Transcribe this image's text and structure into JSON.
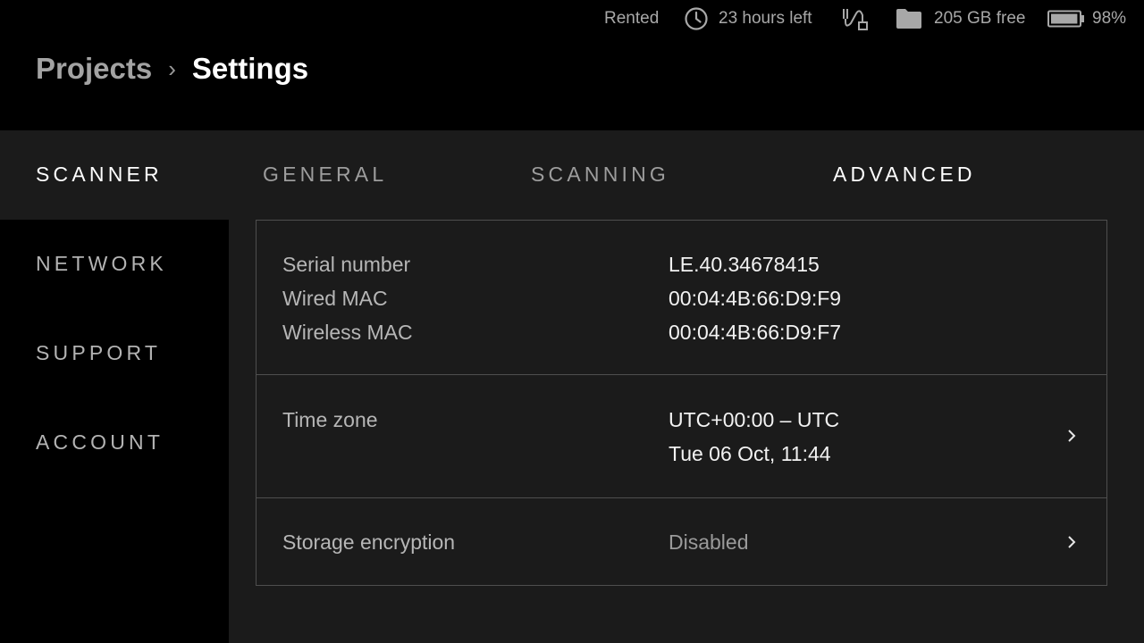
{
  "status": {
    "rental": "Rented",
    "time_left": "23 hours left",
    "storage_free": "205 GB free",
    "battery_percent": "98%",
    "battery_level": 0.98,
    "icons": [
      "clock-icon",
      "cable-icon",
      "folder-icon",
      "battery-icon"
    ]
  },
  "breadcrumb": {
    "parent": "Projects",
    "separator": "›",
    "current": "Settings"
  },
  "sidebar": {
    "items": [
      {
        "label": "SCANNER",
        "active": true
      },
      {
        "label": "NETWORK",
        "active": false
      },
      {
        "label": "SUPPORT",
        "active": false
      },
      {
        "label": "ACCOUNT",
        "active": false
      }
    ]
  },
  "tabs": [
    {
      "label": "GENERAL",
      "active": false
    },
    {
      "label": "SCANNING",
      "active": false
    },
    {
      "label": "ADVANCED",
      "active": true
    }
  ],
  "device_info": {
    "serial_label": "Serial number",
    "serial_value": "LE.40.34678415",
    "wired_mac_label": "Wired MAC",
    "wired_mac_value": "00:04:4B:66:D9:F9",
    "wireless_mac_label": "Wireless MAC",
    "wireless_mac_value": "00:04:4B:66:D9:F7"
  },
  "time_zone": {
    "label": "Time zone",
    "value": "UTC+00:00 – UTC",
    "datetime": "Tue 06 Oct, 11:44"
  },
  "storage_encryption": {
    "label": "Storage encryption",
    "value": "Disabled"
  },
  "colors": {
    "background": "#000000",
    "panel": "#1b1b1b",
    "border": "#4e4e4e",
    "text_primary": "#ffffff",
    "text_muted": "#9a9a9a"
  }
}
